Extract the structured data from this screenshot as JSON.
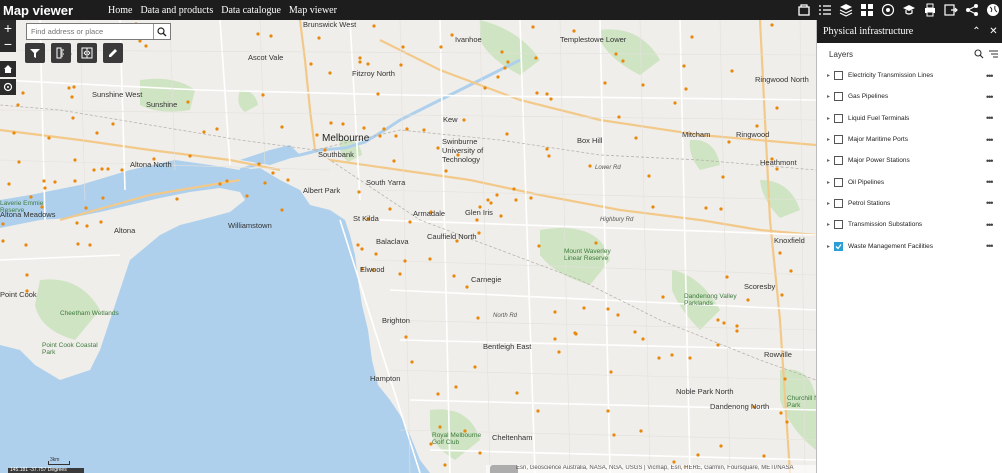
{
  "header": {
    "app_title": "Map viewer",
    "nav": [
      "Home",
      "Data and products",
      "Data catalogue",
      "Map viewer"
    ],
    "icons": [
      "basemap-icon",
      "list-icon",
      "layers-icon",
      "grid-icon",
      "legend-icon",
      "graduation-icon",
      "print-icon",
      "export-icon",
      "share-icon",
      "globe-icon"
    ]
  },
  "search": {
    "placeholder": "Find address or place"
  },
  "map": {
    "zoom_in": "+",
    "zoom_out": "−",
    "scale_label": "3km",
    "coords": "145.181  -37.757 Degrees",
    "attribution": "Esri, Geoscience Australia, NASA, NGA, USGS | Vicmap, Esri, HERE, Garmin, Foursquare, METI/NASA",
    "places": [
      {
        "t": "Brunswick West",
        "c": "mid"
      },
      {
        "t": "Ivanhoe",
        "c": "mid"
      },
      {
        "t": "Templestowe Lower",
        "c": "mid"
      },
      {
        "t": "Ascot Vale",
        "c": "mid"
      },
      {
        "t": "Fitzroy North",
        "c": "mid"
      },
      {
        "t": "Sunshine West",
        "c": "mid"
      },
      {
        "t": "Sunshine",
        "c": "mid"
      },
      {
        "t": "Melbourne",
        "c": "big"
      },
      {
        "t": "Kew",
        "c": "mid"
      },
      {
        "t": "Box Hill",
        "c": "mid"
      },
      {
        "t": "Mitcham",
        "c": "mid"
      },
      {
        "t": "Ringwood",
        "c": "mid"
      },
      {
        "t": "Ringwood North",
        "c": "mid"
      },
      {
        "t": "Heathmont",
        "c": "mid"
      },
      {
        "t": "Southbank",
        "c": "mid"
      },
      {
        "t": "Swinburne University of Technology",
        "c": "mid"
      },
      {
        "t": "Altona North",
        "c": "mid"
      },
      {
        "t": "Albert Park",
        "c": "mid"
      },
      {
        "t": "South Yarra",
        "c": "mid"
      },
      {
        "t": "St Kilda",
        "c": "mid"
      },
      {
        "t": "Armadale",
        "c": "mid"
      },
      {
        "t": "Glen Iris",
        "c": "mid"
      },
      {
        "t": "Williamstown",
        "c": "mid"
      },
      {
        "t": "Altona",
        "c": "mid"
      },
      {
        "t": "Altona Meadows",
        "c": "mid"
      },
      {
        "t": "Balaclava",
        "c": "mid"
      },
      {
        "t": "Caulfield North",
        "c": "mid"
      },
      {
        "t": "Elwood",
        "c": "mid"
      },
      {
        "t": "Carnegie",
        "c": "mid"
      },
      {
        "t": "Mount Waverley Linear Reserve",
        "c": "park"
      },
      {
        "t": "Knoxfield",
        "c": "mid"
      },
      {
        "t": "Scoresby",
        "c": "mid"
      },
      {
        "t": "Dandenong Valley Parklands",
        "c": "park"
      },
      {
        "t": "Point Cook",
        "c": "mid"
      },
      {
        "t": "Cheetham Wetlands",
        "c": "park"
      },
      {
        "t": "Brighton",
        "c": "mid"
      },
      {
        "t": "Bentleigh East",
        "c": "mid"
      },
      {
        "t": "Point Cook Coastal Park",
        "c": "park"
      },
      {
        "t": "Rowville",
        "c": "mid"
      },
      {
        "t": "Hampton",
        "c": "mid"
      },
      {
        "t": "Noble Park North",
        "c": "mid"
      },
      {
        "t": "Dandenong North",
        "c": "mid"
      },
      {
        "t": "Churchill National Park",
        "c": "park"
      },
      {
        "t": "Cheltenham",
        "c": "mid"
      },
      {
        "t": "Royal Melbourne Golf Club",
        "c": "park"
      },
      {
        "t": "North Rd",
        "c": "road"
      },
      {
        "t": "Lower Rd",
        "c": "road"
      },
      {
        "t": "Highbury Rd",
        "c": "road"
      },
      {
        "t": "Laverie Emmie Reserve",
        "c": "park"
      }
    ]
  },
  "panel": {
    "title": "Physical infrastructure",
    "layers_label": "Layers",
    "layers": [
      {
        "name": "Electricity Transmission Lines",
        "checked": false
      },
      {
        "name": "Gas Pipelines",
        "checked": false
      },
      {
        "name": "Liquid Fuel Terminals",
        "checked": false
      },
      {
        "name": "Major Maritime Ports",
        "checked": false
      },
      {
        "name": "Major Power Stations",
        "checked": false
      },
      {
        "name": "Oil Pipelines",
        "checked": false
      },
      {
        "name": "Petrol Stations",
        "checked": false
      },
      {
        "name": "Transmission Substations",
        "checked": false
      },
      {
        "name": "Waste Management Facilities",
        "checked": true
      }
    ]
  },
  "colors": {
    "header_bg": "#1d1d1d",
    "water": "#aed0ec",
    "land": "#f0eeea",
    "park": "#cfe4c3",
    "road": "#ffffff",
    "freeway": "#f6d9a6",
    "facility": "#e8890c",
    "checkbox_on": "#2a9fd6"
  }
}
